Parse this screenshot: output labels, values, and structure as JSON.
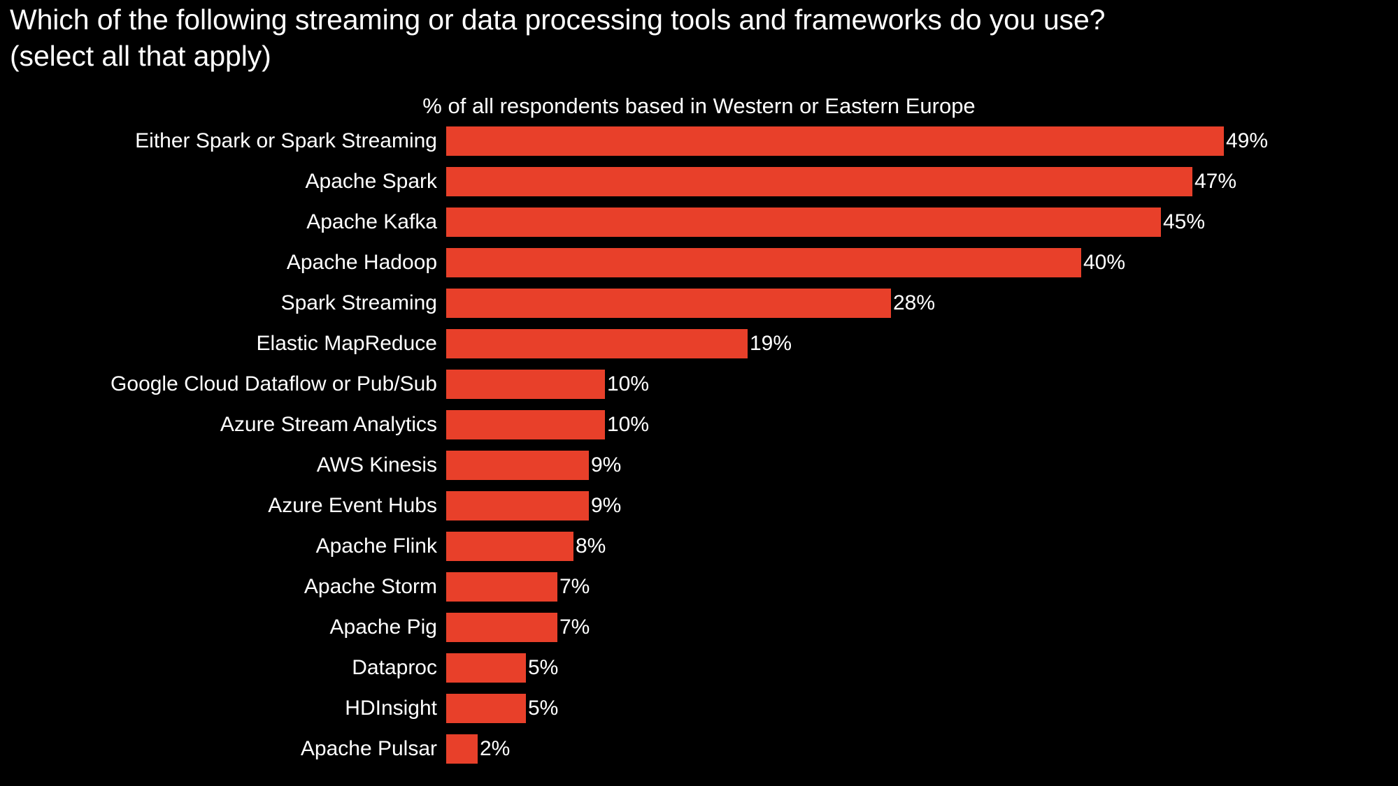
{
  "chart_data": {
    "type": "bar",
    "orientation": "horizontal",
    "title": "Which of the following streaming or data processing tools and frameworks do you use? (select all that apply)",
    "subtitle": "% of all respondents based in Western or Eastern Europe",
    "xlabel": "",
    "ylabel": "",
    "grid": false,
    "legend": "none",
    "bar_color": "#e8402a",
    "background_color": "#000000",
    "text_color": "#ffffff",
    "xlim": [
      0,
      49
    ],
    "value_suffix": "%",
    "categories": [
      "Either Spark or Spark Streaming",
      "Apache Spark",
      "Apache Kafka",
      "Apache Hadoop",
      "Spark Streaming",
      "Elastic MapReduce",
      "Google Cloud Dataflow or Pub/Sub",
      "Azure Stream Analytics",
      "AWS Kinesis",
      "Azure Event Hubs",
      "Apache Flink",
      "Apache Storm",
      "Apache Pig",
      "Dataproc",
      "HDInsight",
      "Apache Pulsar"
    ],
    "values": [
      49,
      47,
      45,
      40,
      28,
      19,
      10,
      10,
      9,
      9,
      8,
      7,
      7,
      5,
      5,
      2
    ],
    "value_labels": [
      "49%",
      "47%",
      "45%",
      "40%",
      "28%",
      "19%",
      "10%",
      "10%",
      "9%",
      "9%",
      "8%",
      "7%",
      "7%",
      "5%",
      "5%",
      "2%"
    ]
  },
  "title_lines": "Which of the following streaming or data processing tools and frameworks do you use?\n(select all that apply)"
}
